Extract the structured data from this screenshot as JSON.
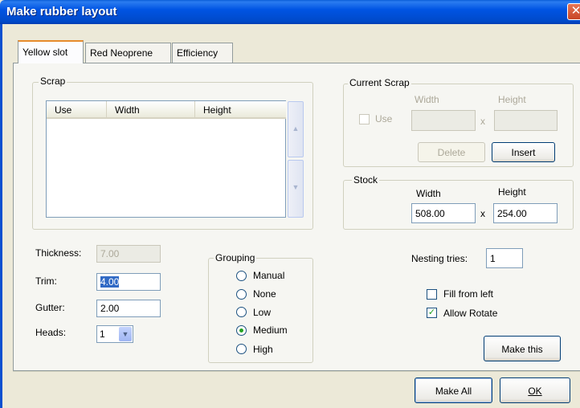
{
  "window": {
    "title": "Make rubber layout",
    "close_glyph": "✕"
  },
  "tabs": [
    {
      "label": "Yellow slot",
      "active": true
    },
    {
      "label": "Red Neoprene",
      "active": false
    },
    {
      "label": "Efficiency",
      "active": false
    }
  ],
  "scrap": {
    "legend": "Scrap",
    "columns": [
      "Use",
      "Width",
      "Height"
    ],
    "rows": []
  },
  "current_scrap": {
    "legend": "Current Scrap",
    "use_label": "Use",
    "width_label": "Width",
    "height_label": "Height",
    "x_label": "x",
    "width_value": "",
    "height_value": "",
    "delete_label": "Delete",
    "insert_label": "Insert"
  },
  "stock": {
    "legend": "Stock",
    "width_label": "Width",
    "height_label": "Height",
    "x_label": "x",
    "width_value": "508.00",
    "height_value": "254.00"
  },
  "fields": {
    "thickness_label": "Thickness:",
    "thickness_value": "7.00",
    "trim_label": "Trim:",
    "trim_value": "4.00",
    "gutter_label": "Gutter:",
    "gutter_value": "2.00",
    "heads_label": "Heads:",
    "heads_value": "1"
  },
  "grouping": {
    "legend": "Grouping",
    "options": [
      "Manual",
      "None",
      "Low",
      "Medium",
      "High"
    ],
    "selected": "Medium"
  },
  "nesting": {
    "label": "Nesting tries:",
    "value": "1"
  },
  "options": {
    "fill_from_left": {
      "label": "Fill from left",
      "checked": false
    },
    "allow_rotate": {
      "label": "Allow Rotate",
      "checked": true
    }
  },
  "buttons": {
    "make_this": "Make this",
    "make_all": "Make All",
    "ok": "OK"
  },
  "colors": {
    "title_bar": "#0054e3",
    "dialog_bg": "#ece9d8",
    "check_mark": "#21a121"
  }
}
